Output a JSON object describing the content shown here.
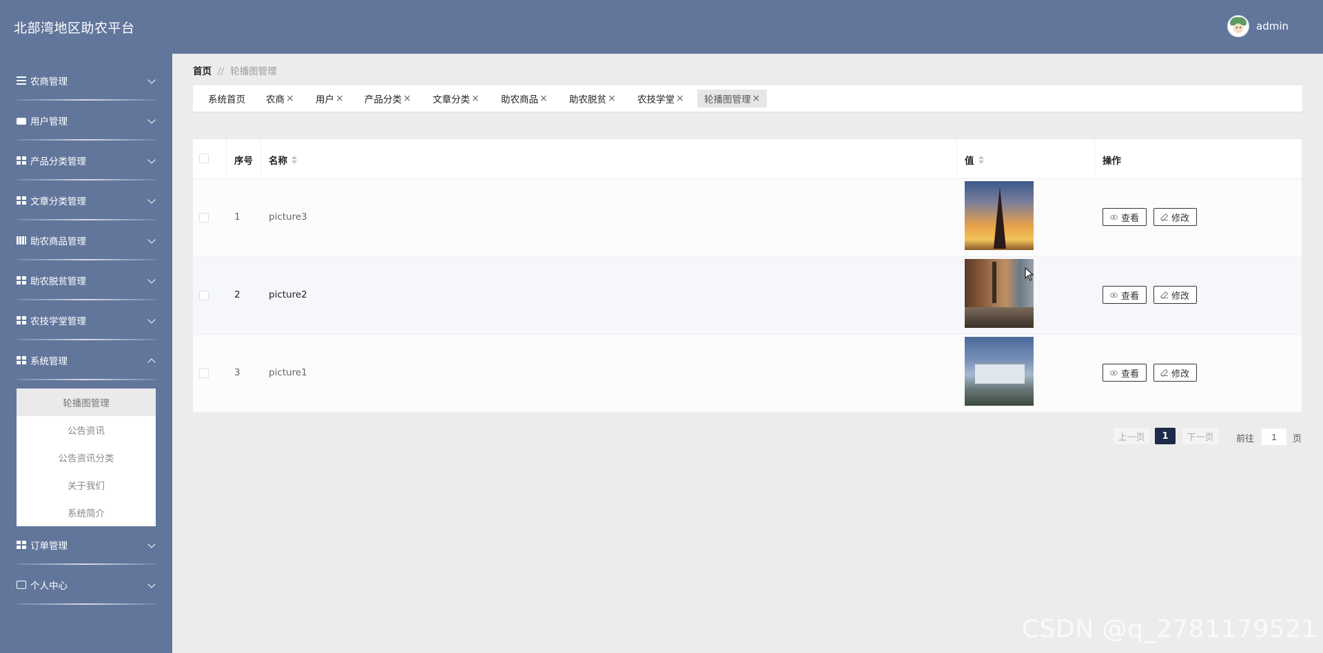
{
  "header": {
    "title": "北部湾地区助农平台",
    "username": "admin"
  },
  "sidebar": {
    "items": [
      {
        "label": "农商管理",
        "icon": "list-icon"
      },
      {
        "label": "用户管理",
        "icon": "briefcase-icon"
      },
      {
        "label": "产品分类管理",
        "icon": "grid-icon"
      },
      {
        "label": "文章分类管理",
        "icon": "grid-icon"
      },
      {
        "label": "助农商品管理",
        "icon": "book-icon"
      },
      {
        "label": "助农脱贫管理",
        "icon": "grid-icon"
      },
      {
        "label": "农技学堂管理",
        "icon": "grid-icon"
      },
      {
        "label": "系统管理",
        "icon": "grid-icon",
        "expanded": true
      },
      {
        "label": "订单管理",
        "icon": "grid-icon"
      },
      {
        "label": "个人中心",
        "icon": "card-icon"
      }
    ],
    "submenu": [
      "轮播图管理",
      "公告资讯",
      "公告资讯分类",
      "关于我们",
      "系统简介"
    ]
  },
  "breadcrumb": {
    "home": "首页",
    "separator": "//",
    "current": "轮播图管理"
  },
  "tabs": [
    "系统首页",
    "农商",
    "用户",
    "产品分类",
    "文章分类",
    "助农商品",
    "助农脱贫",
    "农技学堂",
    "轮播图管理"
  ],
  "tab_close_symbol": "×",
  "table": {
    "headers": {
      "index": "序号",
      "name": "名称",
      "value": "值",
      "actions": "操作"
    },
    "rows": [
      {
        "index": "1",
        "name": "picture3"
      },
      {
        "index": "2",
        "name": "picture2"
      },
      {
        "index": "3",
        "name": "picture1"
      }
    ],
    "view_label": "查看",
    "edit_label": "修改"
  },
  "pagination": {
    "prev": "上一页",
    "current": "1",
    "next": "下一页",
    "goto_prefix": "前往",
    "goto_value": "1",
    "goto_suffix": "页"
  },
  "watermark": "CSDN @q_2781179521",
  "colors": {
    "header_bg": "#62769c",
    "sidebar_bg": "#62769c",
    "page_bg": "#ececec",
    "active_page": "#1d2a4a"
  }
}
